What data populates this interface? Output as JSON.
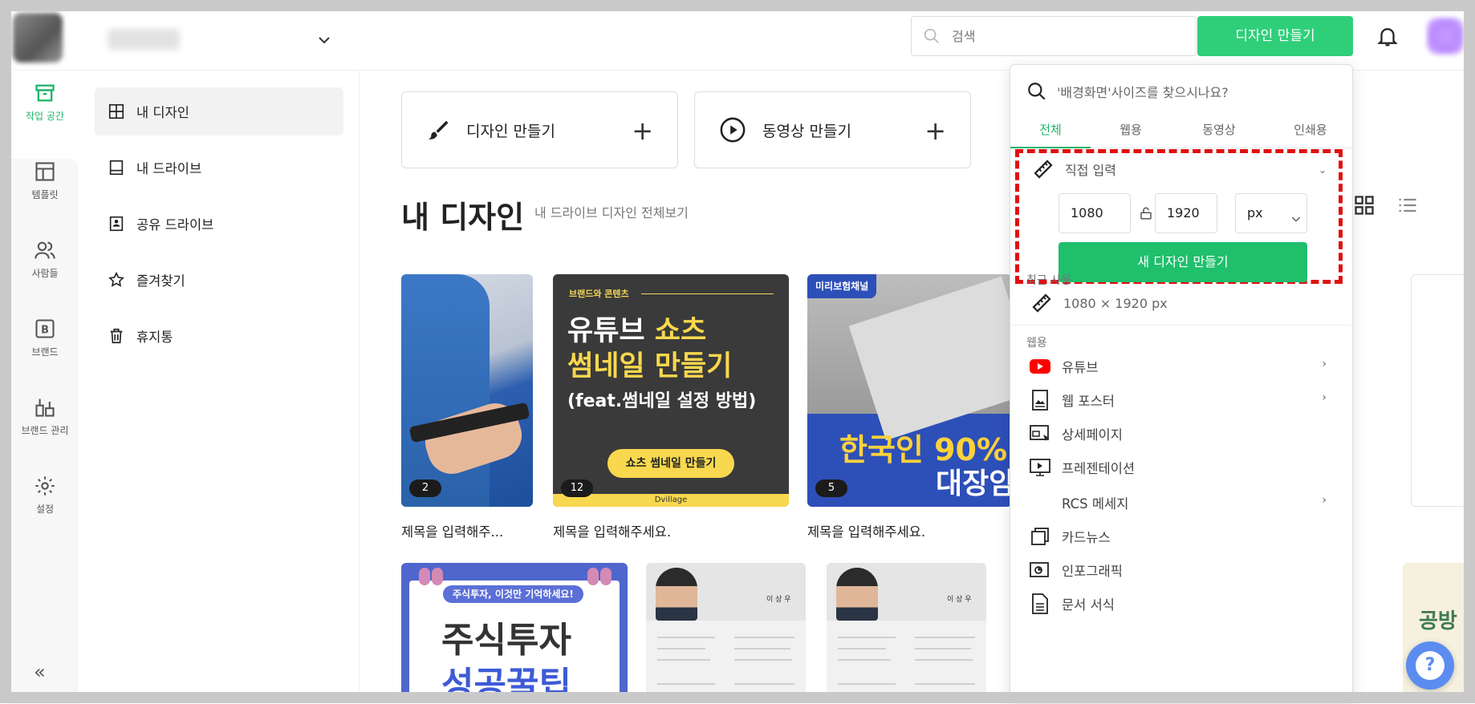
{
  "header": {
    "search_placeholder": "검색",
    "create_button": "디자인 만들기"
  },
  "rail": {
    "items": [
      {
        "label": "작업 공간"
      },
      {
        "label": "템플릿"
      },
      {
        "label": "사람들"
      },
      {
        "label": "브랜드"
      },
      {
        "label": "브랜드 관리"
      },
      {
        "label": "설정"
      }
    ],
    "collapse": "«",
    "active_color": "#1fb56a"
  },
  "sidenav": {
    "items": [
      {
        "label": "내 디자인"
      },
      {
        "label": "내 드라이브"
      },
      {
        "label": "공유 드라이브"
      },
      {
        "label": "즐겨찾기"
      },
      {
        "label": "휴지통"
      }
    ]
  },
  "quick": {
    "design": "디자인 만들기",
    "video": "동영상 만들기",
    "plus": "+"
  },
  "section": {
    "title": "내 디자인",
    "subtitle": "내 드라이브 디자인 전체보기"
  },
  "designs": [
    {
      "caption": "제목을 입력해주...",
      "count": "2"
    },
    {
      "caption": "제목을 입력해주세요.",
      "count": "12"
    },
    {
      "caption": "제목을 입력해주세요.",
      "count": "5"
    }
  ],
  "thumb2": {
    "kicker": "브랜드와 콘텐츠",
    "line1_a": "유튜브 ",
    "line1_b": "쇼츠",
    "line2": "썸네일 만들기",
    "line3": "(feat.썸네일 설정 방법)",
    "pill": "쇼츠 썸네일 만들기",
    "footer": "Dvillage"
  },
  "thumb3": {
    "tag": "미리보험채널",
    "big1": "한국인 90%",
    "big2": "대장암"
  },
  "bottom": {
    "label": "주식투자, 이것만 기억하세요!",
    "h1": "주식투자",
    "h2": "성공꿀팁",
    "resume_name": "이 상 우",
    "peek_text": "공방"
  },
  "panel": {
    "search": "'배경화면'사이즈를 찾으시나요?",
    "tabs": [
      "전체",
      "웹용",
      "동영상",
      "인쇄용"
    ],
    "custom_label": "직접 입력",
    "width": "1080",
    "height": "1920",
    "unit": "px",
    "new_button": "새 디자인 만들기",
    "recent_label": "최근 사용",
    "recent_value": "1080 × 1920 px",
    "web_label": "웹용",
    "items": [
      {
        "label": "유튜브",
        "arrow": "›"
      },
      {
        "label": "웹 포스터",
        "arrow": "›"
      },
      {
        "label": "상세페이지",
        "arrow": ""
      },
      {
        "label": "프레젠테이션",
        "arrow": ""
      },
      {
        "label": "RCS 메세지",
        "arrow": "›"
      },
      {
        "label": "카드뉴스",
        "arrow": ""
      },
      {
        "label": "인포그래픽",
        "arrow": ""
      },
      {
        "label": "문서 서식",
        "arrow": ""
      }
    ],
    "highlight_color": "#e01010"
  },
  "help": "?"
}
